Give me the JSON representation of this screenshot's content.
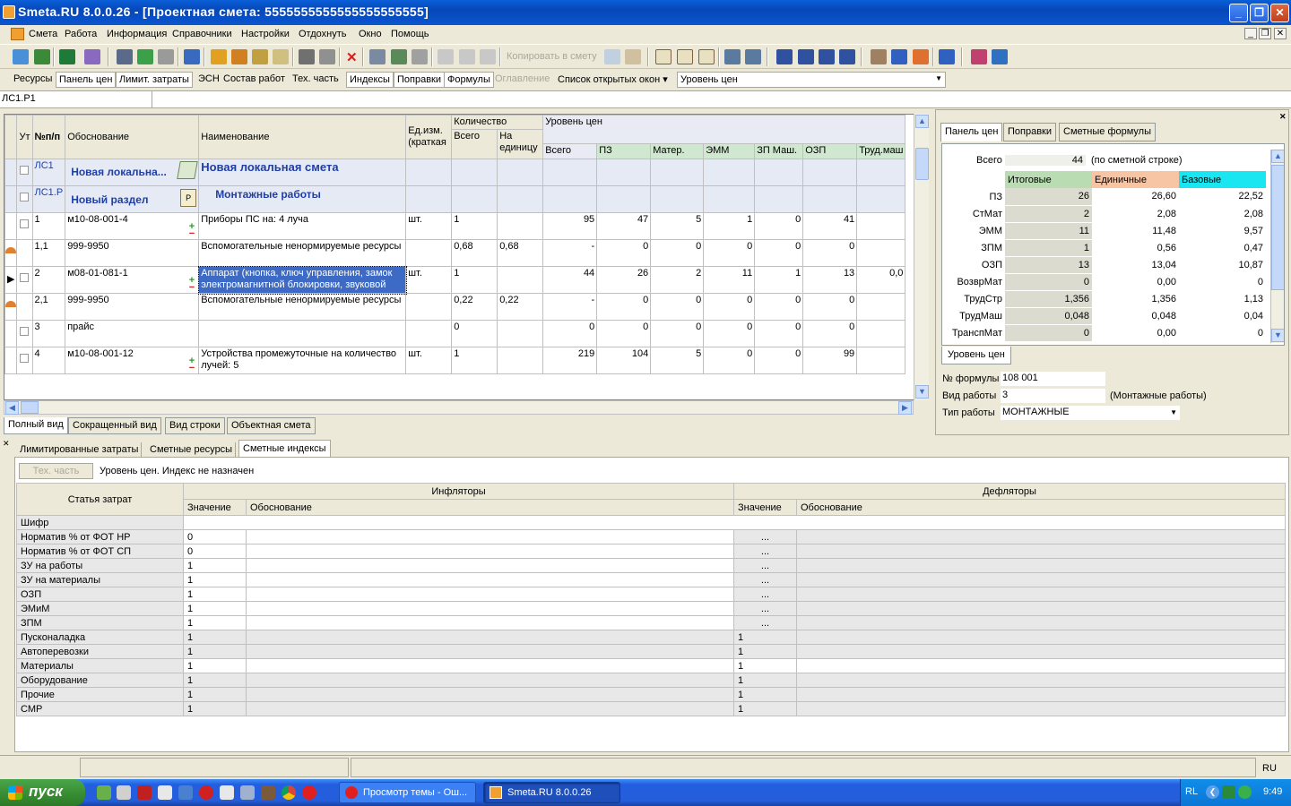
{
  "window": {
    "title": "Smeta.RU  8.0.0.26   - [Проектная смета: 5555555555555555555555]"
  },
  "menu": [
    "Смета",
    "Работа",
    "Информация",
    "Справочники",
    "Настройки",
    "Отдохнуть",
    "Окно",
    "Помощь"
  ],
  "toolbar1": {
    "copy_label": "Копировать в смету"
  },
  "toolbar2": {
    "items": [
      "Ресурсы",
      "Панель цен",
      "Лимит. затраты",
      "ЭСН",
      "Состав работ",
      "Тех. часть",
      "Индексы",
      "Поправки",
      "Формулы",
      "Оглавление",
      "Список открытых окон ▾"
    ],
    "price_level": "Уровень цен"
  },
  "address": "ЛС1.Р1",
  "grid": {
    "headers": {
      "ut": "Ут",
      "num": "№п/п",
      "basis": "Обоснование",
      "name": "Наименование",
      "unit": "Ед.изм. (краткая",
      "qty": "Количество",
      "qty_total": "Всего",
      "qty_unit": "На единицу",
      "price_level": "Уровень цен",
      "total": "Всего",
      "pz": "ПЗ",
      "mat": "Матер.",
      "emm": "ЭММ",
      "zpm": "ЗП Маш.",
      "ozp": "ОЗП",
      "trud": "Труд.маш"
    },
    "rows": [
      {
        "num": "ЛС1",
        "basis": "Новая локальна...",
        "name": "Новая локальная смета",
        "type": "doc"
      },
      {
        "num": "ЛС1.Р",
        "basis": "Новый раздел",
        "name": "Монтажные работы",
        "type": "sec"
      },
      {
        "num": "1",
        "basis": "м10-08-001-4",
        "name": "Приборы ПС на: 4 луча",
        "unit": "шт.",
        "qty": "1",
        "qtyu": "",
        "total": "95",
        "pz": "47",
        "mat": "5",
        "emm": "1",
        "zpm": "0",
        "ozp": "41",
        "trud": ""
      },
      {
        "num": "1,1",
        "basis": "999-9950",
        "name": "Вспомогательные ненормируемые ресурсы",
        "unit": "",
        "qty": "0,68",
        "qtyu": "0,68",
        "total": "-",
        "pz": "0",
        "mat": "0",
        "emm": "0",
        "zpm": "0",
        "ozp": "0",
        "trud": ""
      },
      {
        "num": "2",
        "basis": "м08-01-081-1",
        "name": "Аппарат (кнопка, ключ управления, замок электромагнитной блокировки, звуковой",
        "unit": "шт.",
        "qty": "1",
        "qtyu": "",
        "total": "44",
        "pz": "26",
        "mat": "2",
        "emm": "11",
        "zpm": "1",
        "ozp": "13",
        "trud": "0,0"
      },
      {
        "num": "2,1",
        "basis": "999-9950",
        "name": "Вспомогательные ненормируемые ресурсы",
        "unit": "",
        "qty": "0,22",
        "qtyu": "0,22",
        "total": "-",
        "pz": "0",
        "mat": "0",
        "emm": "0",
        "zpm": "0",
        "ozp": "0",
        "trud": ""
      },
      {
        "num": "3",
        "basis": "прайс",
        "name": "",
        "unit": "",
        "qty": "0",
        "qtyu": "",
        "total": "0",
        "pz": "0",
        "mat": "0",
        "emm": "0",
        "zpm": "0",
        "ozp": "0",
        "trud": ""
      },
      {
        "num": "4",
        "basis": "м10-08-001-12",
        "name": "Устройства промежуточные на количество лучей: 5",
        "unit": "шт.",
        "qty": "1",
        "qtyu": "",
        "total": "219",
        "pz": "104",
        "mat": "5",
        "emm": "0",
        "zpm": "0",
        "ozp": "99",
        "trud": ""
      }
    ]
  },
  "view_tabs": [
    "Полный вид",
    "Сокращенный вид",
    "Вид строки",
    "Объектная смета"
  ],
  "right_panel": {
    "tabs": [
      "Панель цен",
      "Поправки",
      "Сметные формулы"
    ],
    "total_label": "Всего",
    "total_value": "44",
    "total_note": "(по сметной строке)",
    "col_heads": [
      "Итоговые",
      "Единичные",
      "Базовые"
    ],
    "rows": [
      {
        "label": "ПЗ",
        "v": [
          "26",
          "26,60",
          "22,52"
        ]
      },
      {
        "label": "СтМат",
        "v": [
          "2",
          "2,08",
          "2,08"
        ]
      },
      {
        "label": "ЭММ",
        "v": [
          "11",
          "11,48",
          "9,57"
        ]
      },
      {
        "label": "ЗПМ",
        "v": [
          "1",
          "0,56",
          "0,47"
        ]
      },
      {
        "label": "ОЗП",
        "v": [
          "13",
          "13,04",
          "10,87"
        ]
      },
      {
        "label": "ВозврМат",
        "v": [
          "0",
          "0,00",
          "0"
        ]
      },
      {
        "label": "ТрудСтр",
        "v": [
          "1,356",
          "1,356",
          "1,13"
        ]
      },
      {
        "label": "ТрудМаш",
        "v": [
          "0,048",
          "0,048",
          "0,04"
        ]
      },
      {
        "label": "ТранспМат",
        "v": [
          "0",
          "0,00",
          "0"
        ]
      }
    ],
    "bottom_tab": "Уровень цен",
    "formula_label": "№ формулы",
    "formula_value": "108 001",
    "work_kind_label": "Вид работы",
    "work_kind_value": "3",
    "work_kind_note": "(Монтажные работы)",
    "work_type_label": "Тип работы",
    "work_type_value": "МОНТАЖНЫЕ"
  },
  "bottom": {
    "tabs": [
      "Лимитированные затраты",
      "Сметные ресурсы",
      "Сметные индексы"
    ],
    "tech_btn": "Тех. часть",
    "status": "Уровень цен. Индекс не назначен",
    "h_article": "Статья затрат",
    "h_infl": "Инфляторы",
    "h_defl": "Дефляторы",
    "h_value": "Значение",
    "h_basis": "Обоснование",
    "rows": [
      {
        "n": "Шифр",
        "i": "",
        "d": "",
        "t": "code"
      },
      {
        "n": "Норматив % от ФОТ НР",
        "i": "0",
        "d": "...",
        "t": "dots"
      },
      {
        "n": "Норматив % от ФОТ СП",
        "i": "0",
        "d": "...",
        "t": "dots"
      },
      {
        "n": "ЗУ на работы",
        "i": "1",
        "d": "...",
        "t": "dots"
      },
      {
        "n": "ЗУ на материалы",
        "i": "1",
        "d": "...",
        "t": "dots"
      },
      {
        "n": "ОЗП",
        "i": "1",
        "d": "...",
        "t": "dots"
      },
      {
        "n": "ЭМиМ",
        "i": "1",
        "d": "...",
        "t": "dots"
      },
      {
        "n": "ЗПМ",
        "i": "1",
        "d": "...",
        "t": "dots"
      },
      {
        "n": "Пусконаладка",
        "i": "1",
        "d": "1",
        "t": "grey"
      },
      {
        "n": "Автоперевозки",
        "i": "1",
        "d": "1",
        "t": "grey"
      },
      {
        "n": "Материалы",
        "i": "1",
        "d": "1",
        "t": "white"
      },
      {
        "n": "Оборудование",
        "i": "1",
        "d": "1",
        "t": "grey"
      },
      {
        "n": "Прочие",
        "i": "1",
        "d": "1",
        "t": "grey"
      },
      {
        "n": "СМР",
        "i": "1",
        "d": "1",
        "t": "grey"
      }
    ]
  },
  "statusbar": {
    "lang": "RU"
  },
  "taskbar": {
    "start": "пуск",
    "tasks": [
      "Просмотр темы - Ош...",
      "Smeta.RU  8.0.0.26"
    ],
    "tray_lang": "RL",
    "clock": "9:49"
  }
}
